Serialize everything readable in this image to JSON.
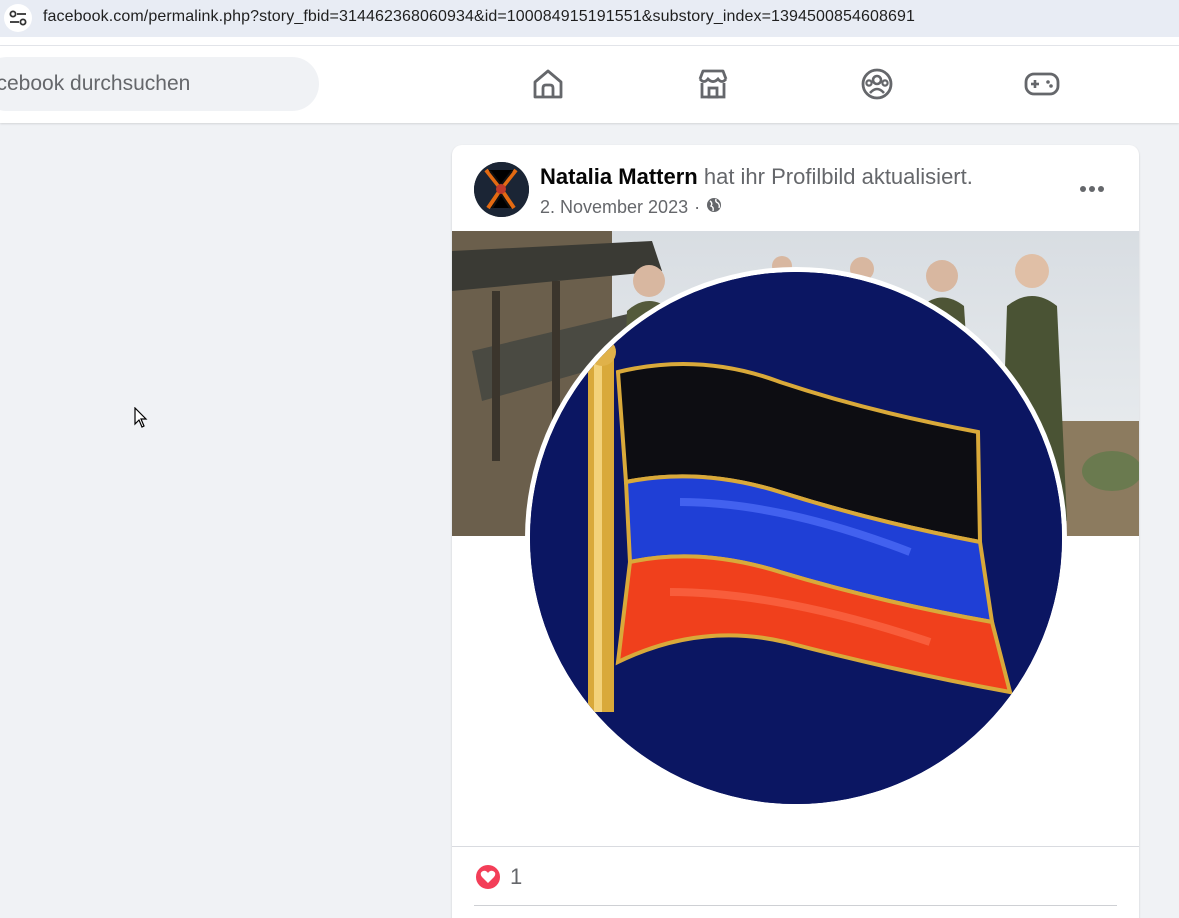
{
  "browser": {
    "url": "facebook.com/permalink.php?story_fbid=314462368060934&id=100084915191551&substory_index=1394500854608691"
  },
  "topnav": {
    "search_placeholder": "Facebook durchsuchen",
    "icons": [
      "home-icon",
      "marketplace-icon",
      "groups-icon",
      "gaming-icon"
    ]
  },
  "post": {
    "author": "Natalia Mattern",
    "action": "hat ihr Profilbild aktualisiert.",
    "date": "2. November 2023",
    "separator": "·",
    "audience_icon": "globe-icon",
    "reaction_count": "1",
    "reaction_icon": "heart-icon"
  },
  "colors": {
    "accent": "#0866ff",
    "heart": "#f33e58",
    "flag_black": "#0d0d12",
    "flag_blue": "#1f3fd6",
    "flag_red": "#f0401c"
  }
}
